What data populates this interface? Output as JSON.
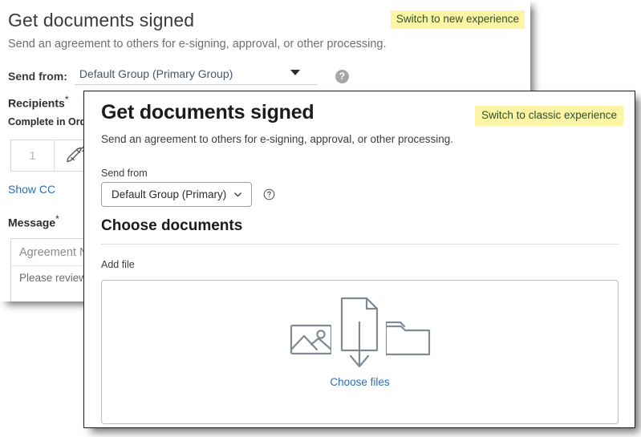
{
  "classic": {
    "title": "Get documents signed",
    "subtitle": "Send an agreement to others for e-signing, approval, or other processing.",
    "switch_link": "Switch to new experience",
    "send_from": {
      "label": "Send from:",
      "value": "Default Group (Primary Group)",
      "help_glyph": "?"
    },
    "recipients_label": "Recipients",
    "required_mark": "*",
    "complete_in_order_label": "Complete in Order",
    "recipient_row": {
      "order_number": "1",
      "role_icon": "signature-pen-icon"
    },
    "show_cc_link": "Show CC",
    "message_label": "Message",
    "message": {
      "agreement_name_placeholder": "Agreement Name",
      "body_placeholder": "Please review and sign this document."
    }
  },
  "modern": {
    "title": "Get documents signed",
    "subtitle": "Send an agreement to others for e-signing, approval, or other processing.",
    "switch_link": "Switch to classic experience",
    "send_from": {
      "label": "Send from",
      "value": "Default Group (Primary)",
      "help_icon": "help-circle-icon",
      "chevron_icon": "chevron-down-icon"
    },
    "choose_documents_title": "Choose documents",
    "add_file_label": "Add file",
    "dropzone": {
      "icons": [
        "image-icon",
        "document-download-icon",
        "folder-icon"
      ],
      "choose_files_link": "Choose files"
    }
  },
  "colors": {
    "highlight_yellow": "#fbf5a5",
    "link_blue": "#2a6ebb",
    "icon_gray": "#808a93",
    "modal_border": "#1c1c1c"
  }
}
